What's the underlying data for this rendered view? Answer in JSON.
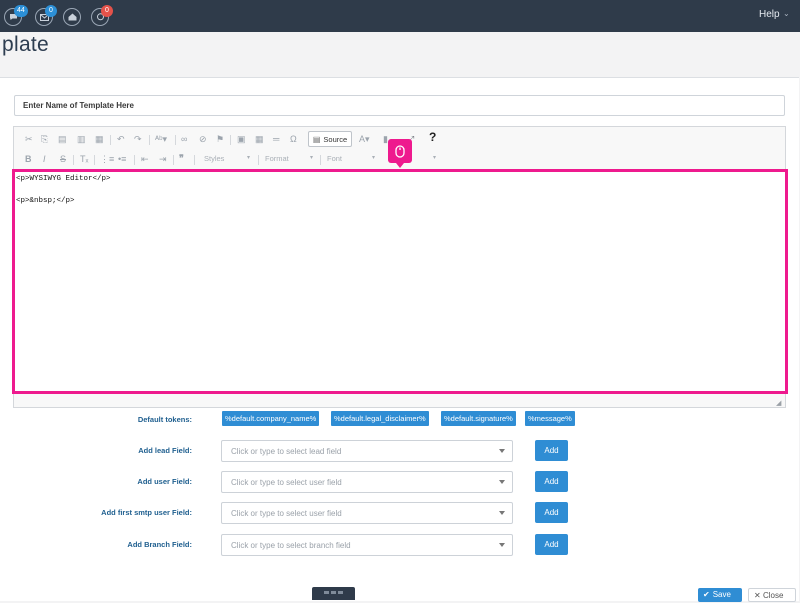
{
  "header": {
    "badges": {
      "conversations": "44",
      "mail": "0",
      "notifications": "0"
    },
    "help_label": "Help",
    "help_caret": "⌄"
  },
  "page_title": "plate",
  "template_name": {
    "placeholder": "Enter Name of Template Here",
    "value": ""
  },
  "toolbar": {
    "source_label": "Source",
    "styles_label": "Styles",
    "format_label": "Format",
    "font_label": "Font"
  },
  "editor": {
    "lines": [
      "<p>WYSIWYG Editor</p>",
      "<p>&nbsp;</p>"
    ]
  },
  "default_tokens": {
    "label": "Default tokens:",
    "items": [
      "%default.company_name%",
      "%default.legal_disclaimer%",
      "%default.signature%",
      "%message%"
    ]
  },
  "fields": [
    {
      "label": "Add lead Field:",
      "placeholder": "Click or type to select lead field",
      "button": "Add"
    },
    {
      "label": "Add user Field:",
      "placeholder": "Click or type to select user field",
      "button": "Add"
    },
    {
      "label": "Add first smtp user Field:",
      "placeholder": "Click or type to select user field",
      "button": "Add"
    },
    {
      "label": "Add Branch Field:",
      "placeholder": "Click or type to select branch field",
      "button": "Add"
    }
  ],
  "footer": {
    "save_label": "Save",
    "close_label": "Close"
  },
  "colors": {
    "topbar": "#2f3b4a",
    "accent_blue": "#2f8dd4",
    "highlight_pink": "#ee1a8e",
    "badge_red": "#e4524a"
  }
}
